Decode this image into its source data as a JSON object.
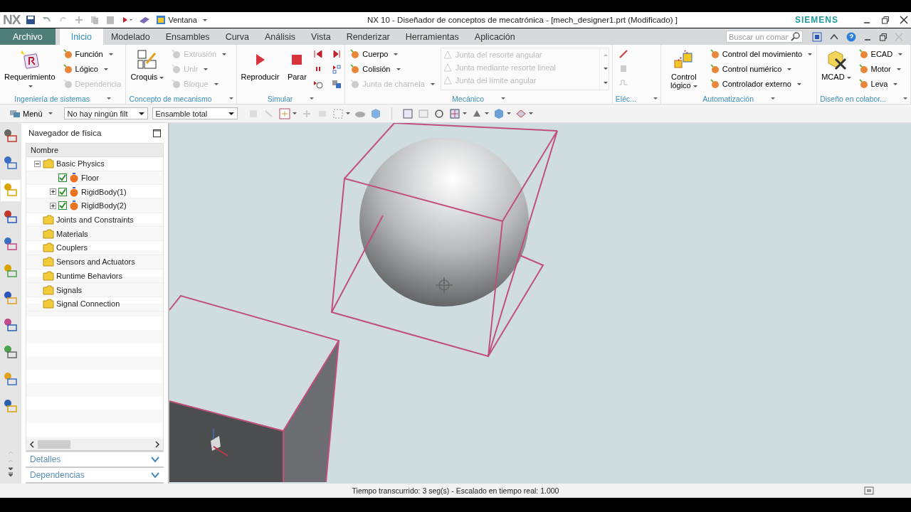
{
  "title_bar": {
    "logo": "NX",
    "window_menu": "Ventana",
    "title": "NX 10 - Diseñador de conceptos de mecatrónica - [mech_designer1.prt (Modificado) ]",
    "brand": "SIEMENS"
  },
  "tabs": [
    {
      "label": "Archivo",
      "kind": "file",
      "selected": false
    },
    {
      "label": "Inicio",
      "kind": "tab",
      "selected": true
    },
    {
      "label": "Modelado",
      "kind": "tab",
      "selected": false
    },
    {
      "label": "Ensambles",
      "kind": "tab",
      "selected": false
    },
    {
      "label": "Curva",
      "kind": "tab",
      "selected": false
    },
    {
      "label": "Análisis",
      "kind": "tab",
      "selected": false
    },
    {
      "label": "Vista",
      "kind": "tab",
      "selected": false
    },
    {
      "label": "Renderizar",
      "kind": "tab",
      "selected": false
    },
    {
      "label": "Herramientas",
      "kind": "tab",
      "selected": false
    },
    {
      "label": "Aplicación",
      "kind": "tab",
      "selected": false
    }
  ],
  "search": {
    "placeholder": "Buscar un coman"
  },
  "ribbon_groups": [
    {
      "label": "Ingeniería de sistemas",
      "kind": "standard",
      "large": [
        {
          "label": "Requerimiento",
          "kind": "requirement",
          "dropdown": true
        }
      ],
      "small": [
        {
          "label": "Función",
          "disabled": false,
          "dropdown": true
        },
        {
          "label": "Lógico",
          "disabled": false,
          "dropdown": true
        },
        {
          "label": "Dependencia",
          "disabled": true,
          "dropdown": false
        }
      ]
    },
    {
      "label": "Concepto de mecanismo",
      "kind": "standard",
      "large": [
        {
          "label": "Croquis",
          "kind": "sketch",
          "dropdown": true
        }
      ],
      "small": [
        {
          "label": "Extrusión",
          "disabled": true,
          "dropdown": true
        },
        {
          "label": "Unir",
          "disabled": true,
          "dropdown": true
        },
        {
          "label": "Bloque",
          "disabled": true,
          "dropdown": true
        }
      ]
    },
    {
      "label": "Simular",
      "kind": "simulate",
      "large": [
        {
          "label": "Reproducir",
          "kind": "play",
          "dropdown": false
        },
        {
          "label": "Parar",
          "kind": "stop",
          "dropdown": false
        }
      ]
    },
    {
      "label": "Mecánico",
      "kind": "gallery",
      "small": [
        {
          "label": "Cuerpo",
          "disabled": false,
          "dropdown": true
        },
        {
          "label": "Colisión",
          "disabled": false,
          "dropdown": true
        },
        {
          "label": "Junta de charnela",
          "disabled": true,
          "dropdown": true
        }
      ],
      "gallery": [
        {
          "label": "Junta del resorte angular",
          "disabled": true
        },
        {
          "label": "Junta mediante resorte lineal",
          "disabled": true
        },
        {
          "label": "Junta del límite angular",
          "disabled": true
        }
      ]
    },
    {
      "label": "Eléc...",
      "kind": "icons"
    },
    {
      "label": "Automatización",
      "kind": "standard",
      "large": [
        {
          "label": "Control lógico",
          "kind": "logic",
          "dropdown": true
        }
      ],
      "small": [
        {
          "label": "Control del movimiento",
          "disabled": false,
          "dropdown": true
        },
        {
          "label": "Control numérico",
          "disabled": false,
          "dropdown": true
        },
        {
          "label": "Controlador externo",
          "disabled": false,
          "dropdown": true
        }
      ]
    },
    {
      "label": "Diseño en colabor...",
      "kind": "standard",
      "large": [
        {
          "label": "MCAD",
          "kind": "mcad",
          "dropdown": true
        }
      ],
      "small": [
        {
          "label": "ECAD",
          "disabled": false,
          "dropdown": true
        },
        {
          "label": "Motor",
          "disabled": false,
          "dropdown": true
        },
        {
          "label": "Leva",
          "disabled": false,
          "dropdown": true
        }
      ]
    }
  ],
  "toolbar": {
    "menu": "Menú",
    "filter": "No hay ningún filt",
    "scope": "Ensamble total"
  },
  "resource_bar": [
    {
      "selected": false
    },
    {
      "selected": false
    },
    {
      "selected": true
    },
    {
      "selected": false
    },
    {
      "selected": false
    },
    {
      "selected": false
    },
    {
      "selected": false
    },
    {
      "selected": false
    },
    {
      "selected": false
    },
    {
      "selected": false
    },
    {
      "selected": false
    }
  ],
  "navigator": {
    "title": "Navegador de física",
    "column": "Nombre",
    "tree": [
      {
        "label": "Basic Physics",
        "kind": "folder",
        "expanded": true,
        "children": [
          {
            "label": "Floor",
            "kind": "body",
            "checked": true
          },
          {
            "label": "RigidBody(1)",
            "kind": "body",
            "checked": true,
            "expanded": false
          },
          {
            "label": "RigidBody(2)",
            "kind": "body",
            "checked": true,
            "expanded": false
          }
        ]
      },
      {
        "label": "Joints and Constraints",
        "kind": "folder"
      },
      {
        "label": "Materials",
        "kind": "folder"
      },
      {
        "label": "Couplers",
        "kind": "folder"
      },
      {
        "label": "Sensors and Actuators",
        "kind": "folder"
      },
      {
        "label": "Runtime Behaviors",
        "kind": "folder"
      },
      {
        "label": "Signals",
        "kind": "folder"
      },
      {
        "label": "Signal Connection",
        "kind": "folder"
      }
    ],
    "panels": [
      "Detalles",
      "Dependencias"
    ]
  },
  "status_bar": "Tiempo transcurrido: 3 seg(s) - Escalado en tiempo real: 1.000"
}
